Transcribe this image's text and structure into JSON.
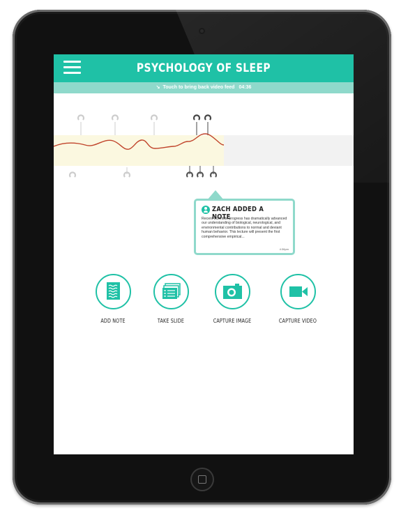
{
  "app": {
    "title": "PSYCHOLOGY OF SLEEP",
    "accent_color": "#1fc1a6",
    "accent_light": "#8fd9cb",
    "menu_icon": "hamburger-menu-icon"
  },
  "video_bar": {
    "message": "Touch to bring back video feed",
    "time": "04:36",
    "icon": "arrow-icon"
  },
  "note_card": {
    "title": "ZACH ADDED A NOTE",
    "body": "Recent scientific progress has dramatically advanced our understanding of biological, neurological, and environmental contributions to normal and deviant human behavior. This lecture will present the first comprehensive empirical...",
    "timestamp": "4:36pm",
    "avatar_icon": "user-avatar-icon"
  },
  "actions": [
    {
      "label": "ADD NOTE",
      "icon": "note-icon"
    },
    {
      "label": "TAKE SLIDE",
      "icon": "slides-icon"
    },
    {
      "label": "CAPTURE IMAGE",
      "icon": "camera-icon"
    },
    {
      "label": "CAPTURE VIDEO",
      "icon": "video-camera-icon"
    }
  ]
}
